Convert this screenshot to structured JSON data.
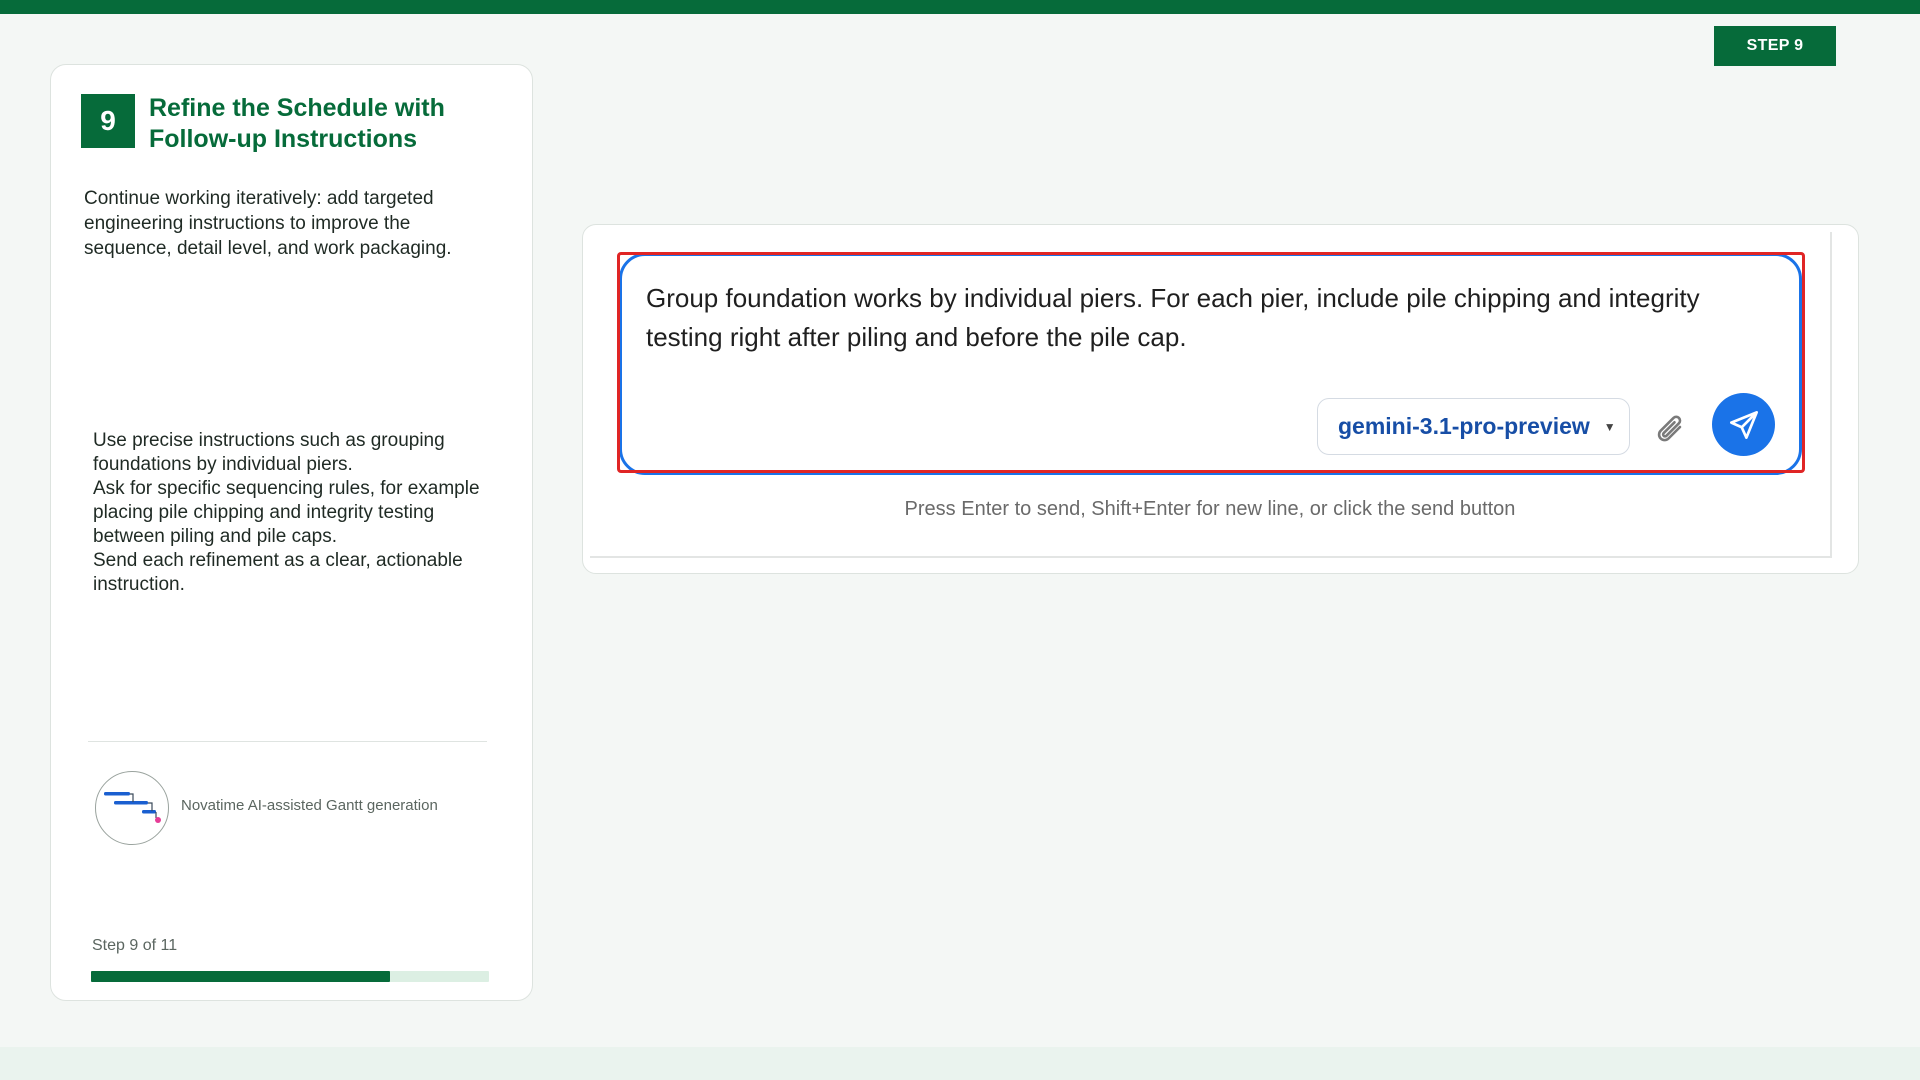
{
  "step_badge": "STEP 9",
  "card": {
    "number": "9",
    "title": "Refine the Schedule with Follow-up Instructions",
    "description": "Continue working iteratively: add targeted engineering instructions to improve the sequence, detail level, and work packaging.",
    "instructions": [
      "Use precise instructions such as grouping foundations by individual piers.",
      "Ask for specific sequencing rules, for example placing pile chipping and integrity testing between piling and pile caps.",
      "Send each refinement as a clear, actionable instruction."
    ],
    "logo_caption": "Novatime AI-assisted Gantt generation",
    "step_counter": "Step 9 of 11",
    "progress": {
      "current": 9,
      "total": 11,
      "fraction": 0.75
    }
  },
  "chat": {
    "message": "Group foundation works by individual piers. For each pier, include pile chipping and integrity testing right after piling and before the pile cap.",
    "model": "gemini-3.1-pro-preview",
    "hint": "Press Enter to send, Shift+Enter for new line, or click the send button"
  },
  "icons": {
    "attach": "paperclip-icon",
    "send": "send-arrow-icon",
    "caret": "caret-down-icon",
    "logo": "gantt-logo-icon"
  },
  "colors": {
    "brand_green": "#066b3a",
    "accent_blue": "#1a73e8",
    "highlight_red": "#e02525"
  }
}
